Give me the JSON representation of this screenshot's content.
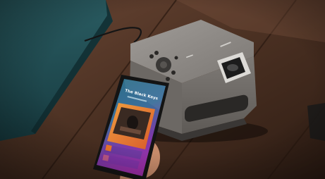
{
  "photo": {
    "subject": "smartphone-controlling-projector",
    "phone_screen_title": "The Black Keys"
  },
  "colors": {
    "wall": "#1f4a4f",
    "table": "#4a3022",
    "projector_body": "#8c8a88",
    "phone_screen_top": "#2c7a8c",
    "phone_screen_bottom": "#9b2fa8",
    "accent_orange": "#e8742a"
  }
}
